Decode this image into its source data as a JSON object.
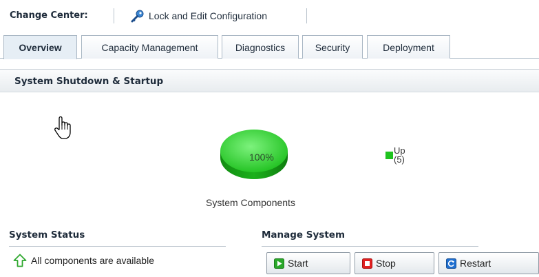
{
  "change_center": {
    "title": "Change Center:",
    "lock_label": "Lock and Edit Configuration",
    "lock_icon": "key-icon"
  },
  "tabs": [
    {
      "label": "Overview",
      "active": true
    },
    {
      "label": "Capacity Management",
      "active": false
    },
    {
      "label": "Diagnostics",
      "active": false
    },
    {
      "label": "Security",
      "active": false
    },
    {
      "label": "Deployment",
      "active": false
    }
  ],
  "panel": {
    "title": "System Shutdown & Startup"
  },
  "chart_data": {
    "type": "pie",
    "categories": [
      "Up"
    ],
    "values": [
      5
    ],
    "percent_label": "100%",
    "legend": [
      {
        "name": "Up",
        "count": "(5)",
        "color": "#1fc31f"
      }
    ],
    "caption": "System Components",
    "legend_position": "right"
  },
  "system_status": {
    "title": "System Status",
    "message": "All components are available",
    "icon": "arrow-up-icon",
    "color": "#2ea82e"
  },
  "manage_system": {
    "title": "Manage System",
    "start_label": "Start",
    "stop_label": "Stop",
    "restart_label": "Restart"
  },
  "colors": {
    "accent": "#1e2b3a",
    "pie_green": "#1fc31f",
    "stop_red": "#e02020",
    "restart_blue": "#1f6fd0"
  }
}
